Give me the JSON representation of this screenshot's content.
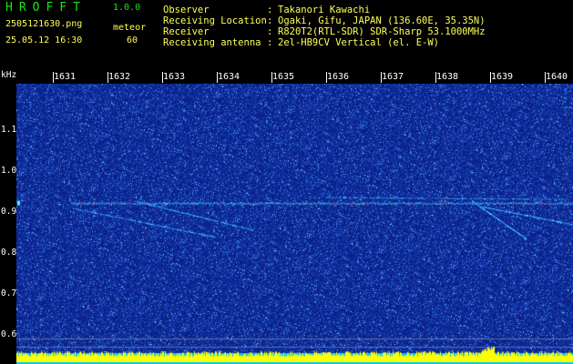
{
  "header": {
    "logo_text": "HROFFT",
    "version": "1.0.0",
    "filename": "2505121630.png",
    "meteor_label": "meteor",
    "datetime": "25.05.12 16:30",
    "meteor_count": "60"
  },
  "info": [
    {
      "label": "Observer",
      "value": "Takanori Kawachi"
    },
    {
      "label": "Receiving Location",
      "value": "Ogaki, Gifu, JAPAN (136.60E, 35.35N)"
    },
    {
      "label": "Receiver",
      "value": "R820T2(RTL-SDR) SDR-Sharp 53.1000MHz"
    },
    {
      "label": "Receiving antenna",
      "value": "2el-HB9CV Vertical (el. E-W)"
    }
  ],
  "info_separator": ":",
  "spectrogram": {
    "unit_label": "kHz",
    "time_labels": [
      "1631",
      "1632",
      "1633",
      "1634",
      "1635",
      "1636",
      "1637",
      "1638",
      "1639",
      "1640"
    ],
    "freq_labels": [
      "1.1",
      "1.0",
      "0.9",
      "0.8",
      "0.7",
      "0.6"
    ],
    "freq_values": [
      1.1,
      1.0,
      0.9,
      0.8,
      0.7,
      0.6
    ],
    "freq_range": [
      0.575,
      1.21
    ],
    "carrier_freq": 0.92,
    "colors": {
      "background": "#0a1e82",
      "noise_dark": "#1432a0",
      "noise_light": "#5aa0ff",
      "trace_hot": "#ff4040",
      "trace_mid": "#40ffff",
      "baseline_fill": "#ffff00",
      "baseline_base": "#00c8ff"
    }
  }
}
